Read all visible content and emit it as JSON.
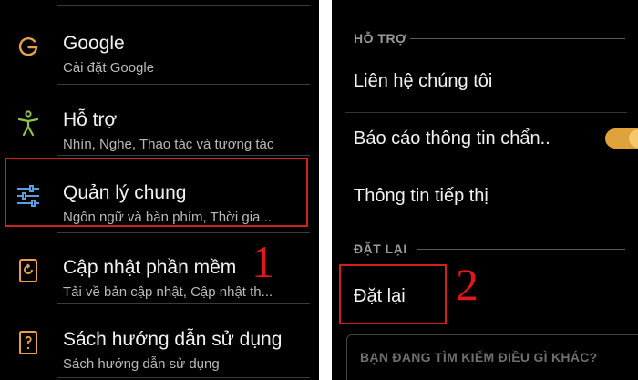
{
  "left": {
    "items": [
      {
        "icon": "google-g-icon",
        "title": "Google",
        "subtitle": "Cài đặt Google"
      },
      {
        "icon": "accessibility-icon",
        "title": "Hỗ trợ",
        "subtitle": "Nhìn, Nghe, Thao tác và tương tác"
      },
      {
        "icon": "sliders-icon",
        "title": "Quản lý chung",
        "subtitle": "Ngôn ngữ và bàn phím, Thời gia..."
      },
      {
        "icon": "software-update-icon",
        "title": "Cập nhật phần mềm",
        "subtitle": "Tải về bản cập nhật, Cập nhật th..."
      },
      {
        "icon": "user-manual-icon",
        "title": "Sách hướng dẫn sử dụng",
        "subtitle": "Sách hướng dẫn sử dụng"
      }
    ],
    "step_number": "1"
  },
  "right": {
    "support_header": "HỖ TRỢ",
    "support_items": [
      "Liên hệ chúng tôi",
      "Báo cáo thông tin chẩn..",
      "Thông tin tiếp thị"
    ],
    "diagnostic_toggle_on": true,
    "reset_header": "ĐẶT LẠI",
    "reset_item": "Đặt lại",
    "search_placeholder": "BẠN ĐANG TÌM KIẾM ĐIỀU GÌ KHÁC?",
    "step_number": "2"
  },
  "colors": {
    "background": "#000000",
    "highlight": "#d02020",
    "toggle": "#e0a23a"
  }
}
